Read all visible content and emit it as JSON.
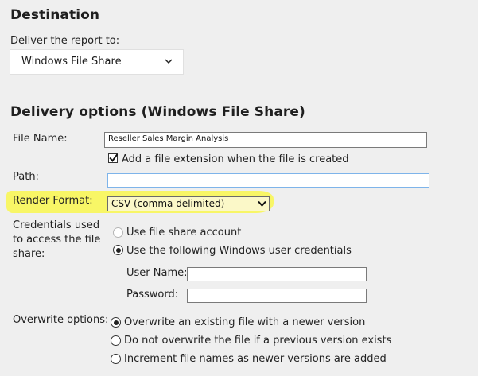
{
  "destination": {
    "heading": "Destination",
    "deliver_label": "Deliver the report to:",
    "deliver_value": "Windows File Share"
  },
  "delivery": {
    "heading": "Delivery options (Windows File Share)",
    "file_name_label": "File Name:",
    "file_name_value": "Reseller Sales Margin Analysis",
    "add_extension_label": "Add a file extension when the file is created",
    "add_extension_checked": true,
    "path_label": "Path:",
    "path_value": "",
    "render_format_label": "Render Format:",
    "render_format_value": "CSV (comma delimited)",
    "credentials_label_line1": "Credentials used",
    "credentials_label_line2": "to access the file",
    "credentials_label_line3": "share:",
    "use_file_share_account": "Use file share account",
    "use_windows_credentials": "Use the following Windows user credentials",
    "user_name_label": "User Name:",
    "password_label": "Password:",
    "overwrite_label": "Overwrite options:",
    "overwrite_newer": "Overwrite an existing file with a newer version",
    "do_not_overwrite": "Do not overwrite the file if a previous version exists",
    "increment_names": "Increment file names as newer versions are added"
  },
  "icons": {
    "deliver_chevron": "chevron-down-icon",
    "render_arrow": "dropdown-arrow-icon",
    "checkbox_check": "check-icon"
  },
  "colors": {
    "highlight": "#f9f65a",
    "background": "#efefef",
    "path_border": "#7eb4ea"
  }
}
